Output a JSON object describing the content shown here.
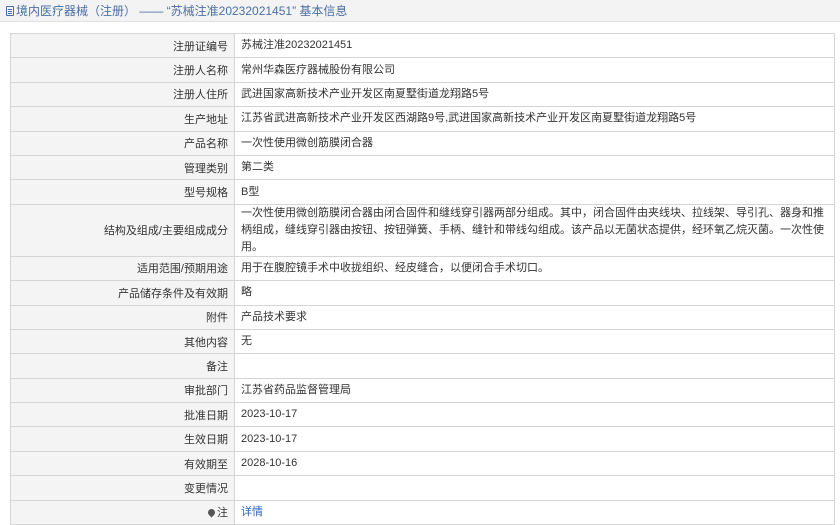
{
  "header": {
    "icon": "document-icon",
    "text": "境内医疗器械（注册） —— “苏械注准20232021451” 基本信息"
  },
  "rows": [
    {
      "label": "注册证编号",
      "value": "苏械注准20232021451"
    },
    {
      "label": "注册人名称",
      "value": "常州华森医疗器械股份有限公司"
    },
    {
      "label": "注册人住所",
      "value": "武进国家高新技术产业开发区南夏墅街道龙翔路5号"
    },
    {
      "label": "生产地址",
      "value": "江苏省武进高新技术产业开发区西湖路9号,武进国家高新技术产业开发区南夏墅街道龙翔路5号"
    },
    {
      "label": "产品名称",
      "value": "一次性使用微创筋膜闭合器"
    },
    {
      "label": "管理类别",
      "value": "第二类"
    },
    {
      "label": "型号规格",
      "value": "B型"
    },
    {
      "label": "结构及组成/主要组成成分",
      "value": "一次性使用微创筋膜闭合器由闭合固件和缝线穿引器两部分组成。其中，闭合固件由夹线块、拉线架、导引孔、器身和推柄组成，缝线穿引器由按钮、按钮弹簧、手柄、缝针和带线勾组成。该产品以无菌状态提供，经环氧乙烷灭菌。一次性使用。"
    },
    {
      "label": "适用范围/预期用途",
      "value": "用于在腹腔镜手术中收拢组织、经皮缝合，以便闭合手术切口。"
    },
    {
      "label": "产品储存条件及有效期",
      "value": "略"
    },
    {
      "label": "附件",
      "value": "产品技术要求"
    },
    {
      "label": "其他内容",
      "value": "无"
    },
    {
      "label": "备注",
      "value": ""
    },
    {
      "label": "审批部门",
      "value": "江苏省药品监督管理局"
    },
    {
      "label": "批准日期",
      "value": "2023-10-17"
    },
    {
      "label": "生效日期",
      "value": "2023-10-17"
    },
    {
      "label": "有效期至",
      "value": "2028-10-16"
    },
    {
      "label": "变更情况",
      "value": ""
    }
  ],
  "note_row": {
    "icon": "pin-icon",
    "label": "注",
    "link": "详情",
    "link_color": "#2a62bc"
  }
}
